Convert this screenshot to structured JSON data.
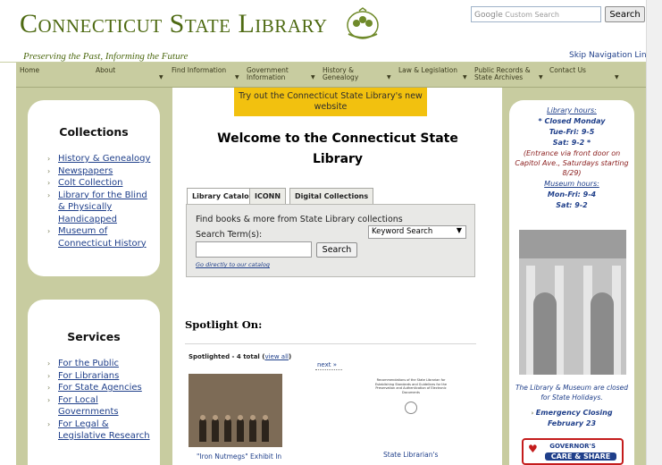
{
  "header": {
    "site_title": "Connecticut State Library",
    "tagline": "Preserving the Past, Informing the Future",
    "search": {
      "brand": "Google",
      "placeholder": "Custom Search",
      "button": "Search"
    },
    "skip_nav": "Skip Navigation Links"
  },
  "nav": [
    {
      "label": "Home",
      "has_menu": false
    },
    {
      "label": "About",
      "has_menu": true
    },
    {
      "label": "Find Information",
      "has_menu": true
    },
    {
      "label": "Government Information",
      "has_menu": true
    },
    {
      "label": "History & Genealogy",
      "has_menu": true
    },
    {
      "label": "Law & Legislation",
      "has_menu": true
    },
    {
      "label": "Public Records & State Archives",
      "has_menu": true
    },
    {
      "label": "Contact Us",
      "has_menu": true
    }
  ],
  "collections": {
    "title": "Collections",
    "items": [
      "History & Genealogy",
      "Newspapers",
      "Colt Collection",
      "Library for the Blind & Physically Handicapped",
      "Museum of Connecticut History"
    ]
  },
  "services": {
    "title": "Services",
    "items": [
      "For the Public",
      "For Librarians",
      "For State Agencies",
      "For Local Governments",
      "For Legal & Legislative Research"
    ]
  },
  "main": {
    "banner": "Try out the Connecticut State Library's new website",
    "welcome": "Welcome to the Connecticut State Library",
    "tabs": [
      "Library Catalog",
      "ICONN",
      "Digital Collections"
    ],
    "catalog": {
      "find_text": "Find books & more from State Library collections",
      "term_label": "Search Term(s):",
      "term_value": "",
      "search_type": "Keyword Search",
      "search_button": "Search",
      "direct_link": "Go directly to our catalog"
    },
    "spotlight": {
      "heading": "Spotlight On:",
      "count_text": "Spotlighted - 4 total (",
      "view_all": "view all",
      "count_end": ")",
      "next": "next »",
      "item1_caption": "\"Iron Nutmegs\" Exhibit In",
      "item2_doc": "Recommendations of the State Librarian for Establishing Standards and Guidelines for the Preservation and Authentication of Electronic Documents",
      "item2_caption": "State Librarian's"
    }
  },
  "sidebar_right": {
    "hours_label": "Library hours:",
    "line1": "* Closed Monday",
    "line2": "Tue-Fri: 9-5",
    "line3": "Sat: 9-2 *",
    "entrance": "(Entrance via front door on Capitol Ave., Saturdays starting 8/29)",
    "museum_label": "Museum hours:",
    "museum1": "Mon-Fri: 9-4",
    "museum2": "Sat: 9-2",
    "holiday": "The Library & Museum are closed for State Holidays.",
    "emergency": "Emergency Closing February 23",
    "care_top": "GOVERNOR'S",
    "care_bottom": "CARE & SHARE"
  }
}
